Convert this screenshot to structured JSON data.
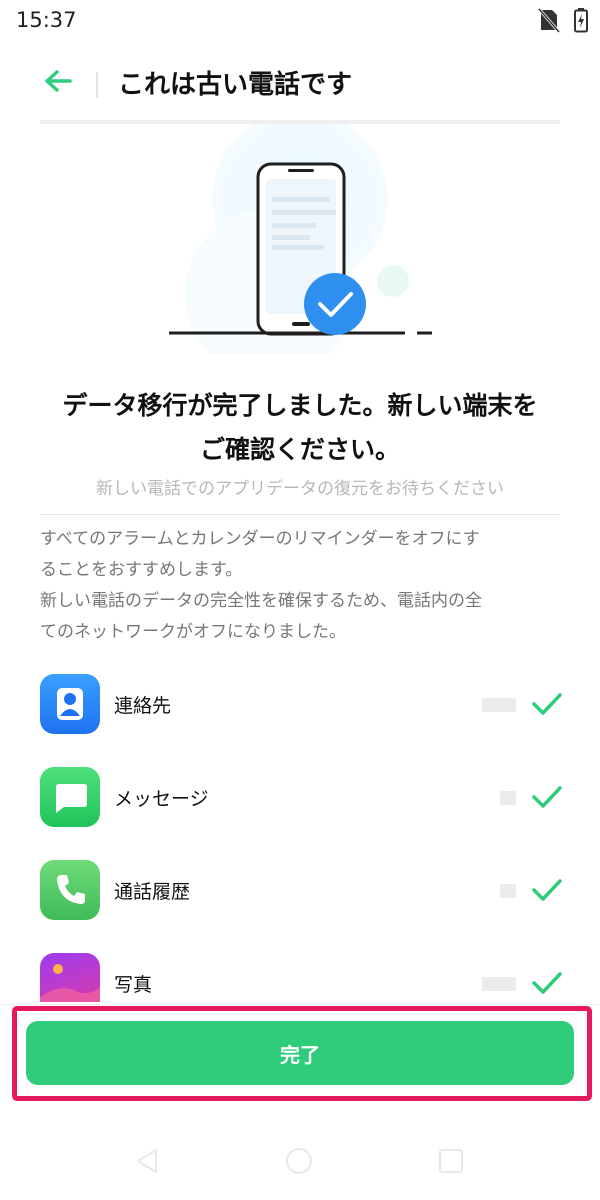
{
  "status_bar": {
    "time": "15:37",
    "icons": [
      "no-sim-icon",
      "battery-charging-icon"
    ]
  },
  "header": {
    "back_icon": "arrow-left-icon",
    "title": "これは古い電話です"
  },
  "illustration": {
    "icon": "phone-check-illustration"
  },
  "message": {
    "headline_line1": "データ移行が完了しました。新しい端末を",
    "headline_line2": "ご確認ください。",
    "subtitle": "新しい電話でのアプリデータの復元をお待ちください"
  },
  "notice": {
    "line1": "すべてのアラームとカレンダーのリマインダーをオフにす",
    "line2": "ることをおすすめします。",
    "line3": "新しい電話のデータの完全性を確保するため、電話内の全",
    "line4": "てのネットワークがオフになりました。"
  },
  "data_items": [
    {
      "label": "連絡先",
      "icon": "contacts-icon",
      "status": "check-icon"
    },
    {
      "label": "メッセージ",
      "icon": "messages-icon",
      "status": "check-icon"
    },
    {
      "label": "通話履歴",
      "icon": "call-log-icon",
      "status": "check-icon"
    },
    {
      "label": "写真",
      "icon": "photos-icon",
      "status": "check-icon"
    }
  ],
  "done_button": {
    "label": "完了"
  },
  "colors": {
    "accent": "#2fcc7b",
    "highlight": "#e5195f",
    "illustration_blue": "#2f8ff0"
  },
  "nav_bar": {
    "icons": [
      "back-triangle-icon",
      "home-circle-icon",
      "recents-square-icon"
    ]
  }
}
